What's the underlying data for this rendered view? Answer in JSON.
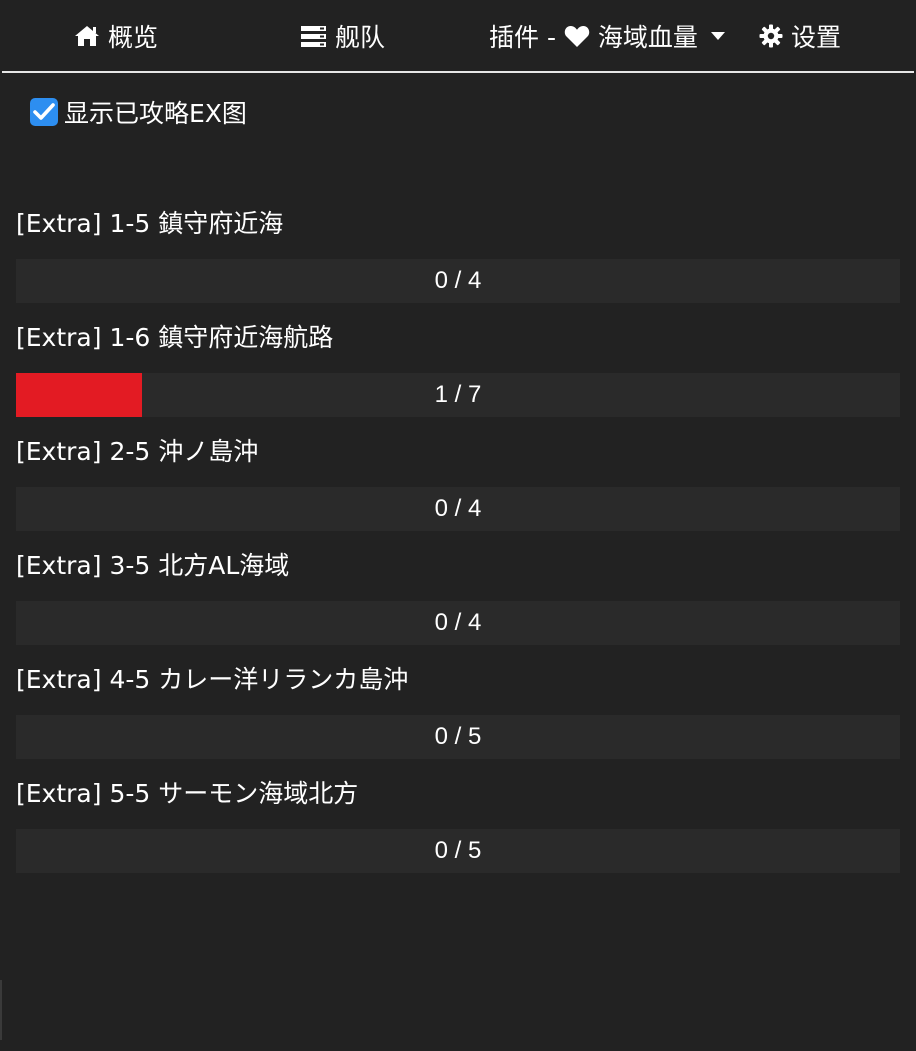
{
  "nav": {
    "overview": {
      "label": "概览",
      "icon": "home-icon"
    },
    "fleet": {
      "label": "舰队",
      "icon": "server-icon"
    },
    "plugin": {
      "prefix": "插件 - ",
      "label": "海域血量",
      "icon": "heart-icon",
      "dropdown_icon": "caret-down-icon"
    },
    "settings": {
      "label": "设置",
      "icon": "gear-icon"
    }
  },
  "show_cleared": {
    "label": "显示已攻略EX图",
    "checked": true
  },
  "colors": {
    "accent": "#2d8ef0",
    "hp_fill": "#e31b23",
    "bar_bg": "#2a2a2a",
    "background": "#222222"
  },
  "maps": [
    {
      "title": "[Extra] 1-5 鎮守府近海",
      "progress": "0 / 4",
      "current": 0,
      "total": 4
    },
    {
      "title": "[Extra] 1-6 鎮守府近海航路",
      "progress": "1 / 7",
      "current": 1,
      "total": 7
    },
    {
      "title": "[Extra] 2-5 沖ノ島沖",
      "progress": "0 / 4",
      "current": 0,
      "total": 4
    },
    {
      "title": "[Extra] 3-5 北方AL海域",
      "progress": "0 / 4",
      "current": 0,
      "total": 4
    },
    {
      "title": "[Extra] 4-5 カレー洋リランカ島沖",
      "progress": "0 / 5",
      "current": 0,
      "total": 5
    },
    {
      "title": "[Extra] 5-5 サーモン海域北方",
      "progress": "0 / 5",
      "current": 0,
      "total": 5
    }
  ]
}
